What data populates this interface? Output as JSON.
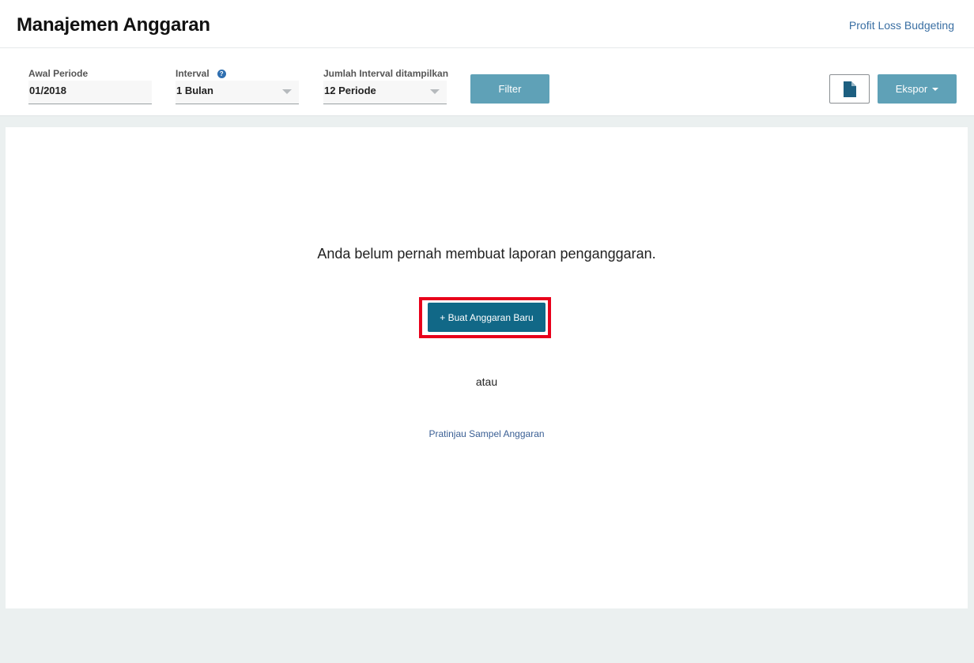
{
  "header": {
    "title": "Manajemen Anggaran",
    "link_label": "Profit Loss Budgeting"
  },
  "filters": {
    "start_period": {
      "label": "Awal Periode",
      "value": "01/2018"
    },
    "interval": {
      "label": "Interval",
      "value": "1 Bulan",
      "help_icon": "question-circle-icon"
    },
    "interval_count": {
      "label": "Jumlah Interval ditampilkan",
      "value": "12 Periode"
    },
    "filter_label": "Filter",
    "document_icon": "file-icon",
    "export_label": "Ekspor"
  },
  "main": {
    "empty_message": "Anda belum pernah membuat laporan penganggaran.",
    "create_label": "+ Buat Anggaran Baru",
    "or_text": "atau",
    "preview_link": "Pratinjau Sampel Anggaran"
  },
  "colors": {
    "accent": "#5fa1b7",
    "primary": "#116887",
    "highlight": "#e8001b",
    "link": "#3a6fa3"
  }
}
